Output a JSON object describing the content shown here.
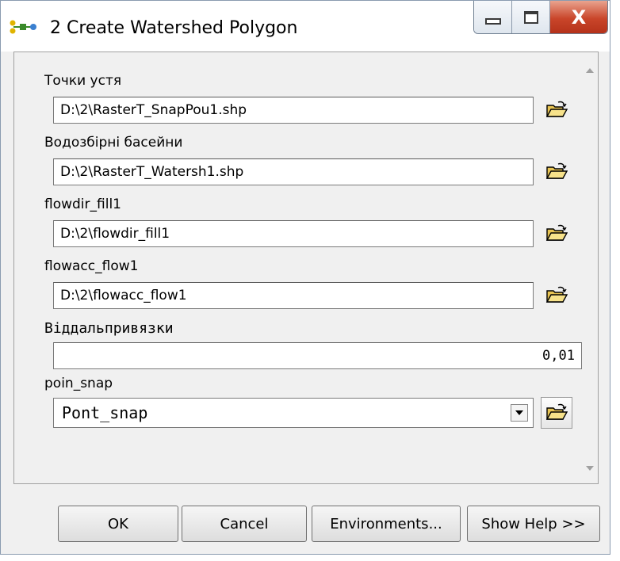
{
  "window": {
    "title": "2 Create Watershed Polygon",
    "close_glyph": "X",
    "icon": "model-icon"
  },
  "form": {
    "fields": [
      {
        "label": "Точки устя",
        "value": "D:\\2\\RasterT_SnapPou1.shp"
      },
      {
        "label": "Водозбірні басейни",
        "value": "D:\\2\\RasterT_Watersh1.shp"
      },
      {
        "label": "flowdir_fill1",
        "value": "D:\\2\\flowdir_fill1"
      },
      {
        "label": "flowacc_flow1",
        "value": "D:\\2\\flowacc_flow1"
      }
    ],
    "distance": {
      "label": "Віддальпривязки",
      "value": "0,01"
    },
    "poin_snap": {
      "label": "poin_snap",
      "selected": "Pont_snap"
    }
  },
  "buttons": {
    "ok": "OK",
    "cancel": "Cancel",
    "environments": "Environments...",
    "show_help": "Show Help >>"
  },
  "colors": {
    "close_button": "#c9452a",
    "folder_yellow": "#f2d35c"
  }
}
